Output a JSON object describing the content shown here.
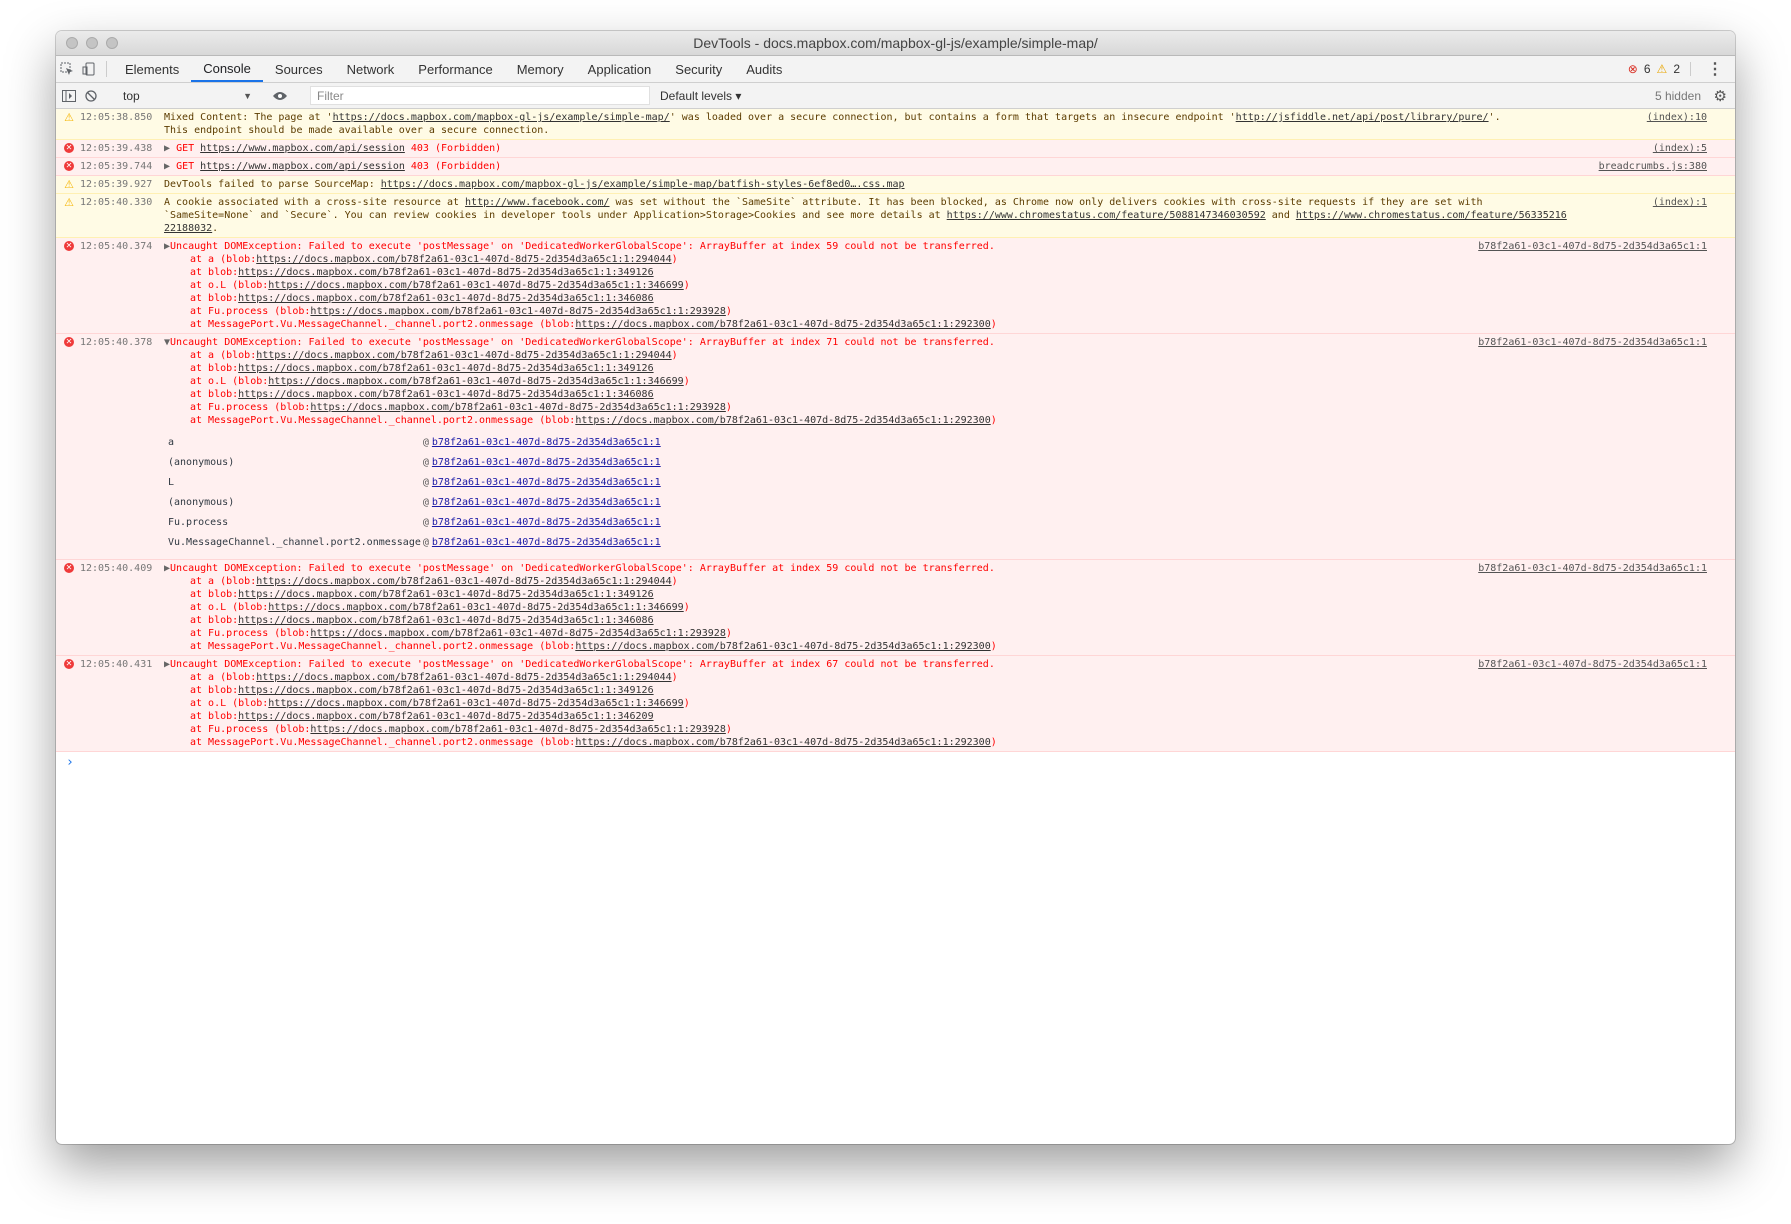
{
  "window": {
    "title": "DevTools - docs.mapbox.com/mapbox-gl-js/example/simple-map/"
  },
  "tabs": [
    "Elements",
    "Console",
    "Sources",
    "Network",
    "Performance",
    "Memory",
    "Application",
    "Security",
    "Audits"
  ],
  "active_tab": "Console",
  "counts": {
    "errors": "6",
    "warnings": "2"
  },
  "toolbar": {
    "context": "top",
    "filter_placeholder": "Filter",
    "levels": "Default levels ▾",
    "hidden": "5 hidden"
  },
  "colors": {
    "error_bg": "#fff0f0",
    "warn_bg": "#fffbe5",
    "error_text": "#ff0000",
    "accent": "#1a73e8"
  },
  "messages": {
    "m1": {
      "time": "12:05:38.850",
      "src": "(index):10",
      "t1": "Mixed Content: The page at '",
      "l1": "https://docs.mapbox.com/mapbox-gl-js/example/simple-map/",
      "t2": "' was loaded over a secure connection, but contains a form that targets an insecure endpoint '",
      "l2": "http://jsfiddle.net/api/post/library/pure/",
      "t3": "'.",
      "t4": "This endpoint should be made available over a secure connection."
    },
    "m2": {
      "time": "12:05:39.438",
      "method": "GET",
      "url": "https://www.mapbox.com/api/session",
      "status": "403 (Forbidden)",
      "src": "(index):5"
    },
    "m3": {
      "time": "12:05:39.744",
      "method": "GET",
      "url": "https://www.mapbox.com/api/session",
      "status": "403 (Forbidden)",
      "src": "breadcrumbs.js:380"
    },
    "m4": {
      "time": "12:05:39.927",
      "text": "DevTools failed to parse SourceMap: ",
      "link": "https://docs.mapbox.com/mapbox-gl-js/example/simple-map/batfish-styles-6ef8ed0….css.map"
    },
    "m5": {
      "time": "12:05:40.330",
      "src": "(index):1",
      "t1": "A cookie associated with a cross-site resource at ",
      "l1": "http://www.facebook.com/",
      "t2": " was set without the `SameSite` attribute. It has been blocked, as Chrome now only delivers cookies with cross-site requests if they are set with",
      "t3": "`SameSite=None` and `Secure`. You can review cookies in developer tools under Application>Storage>Cookies and see more details at ",
      "l2": "https://www.chromestatus.com/feature/5088147346030592",
      "t4": " and ",
      "l3": "https://www.chromestatus.com/feature/56335216",
      "l4": "22188032",
      "t5": "."
    },
    "e1": {
      "time": "12:05:40.374",
      "src": "b78f2a61-03c1-407d-8d75-2d354d3a65c1:1",
      "head": "Uncaught DOMException: Failed to execute 'postMessage' on 'DedicatedWorkerGlobalScope': ArrayBuffer at index 59 could not be transferred.",
      "s1a": "at a (blob:",
      "s1b": "https://docs.mapbox.com/b78f2a61-03c1-407d-8d75-2d354d3a65c1:1:294044",
      "s1c": ")",
      "s2a": "at blob:",
      "s2b": "https://docs.mapbox.com/b78f2a61-03c1-407d-8d75-2d354d3a65c1:1:349126",
      "s3a": "at o.L (blob:",
      "s3b": "https://docs.mapbox.com/b78f2a61-03c1-407d-8d75-2d354d3a65c1:1:346699",
      "s3c": ")",
      "s4a": "at blob:",
      "s4b": "https://docs.mapbox.com/b78f2a61-03c1-407d-8d75-2d354d3a65c1:1:346086",
      "s5a": "at Fu.process (blob:",
      "s5b": "https://docs.mapbox.com/b78f2a61-03c1-407d-8d75-2d354d3a65c1:1:293928",
      "s5c": ")",
      "s6a": "at MessagePort.Vu.MessageChannel._channel.port2.onmessage (blob:",
      "s6b": "https://docs.mapbox.com/b78f2a61-03c1-407d-8d75-2d354d3a65c1:1:292300",
      "s6c": ")"
    },
    "e2": {
      "time": "12:05:40.378",
      "src": "b78f2a61-03c1-407d-8d75-2d354d3a65c1:1",
      "head": "Uncaught DOMException: Failed to execute 'postMessage' on 'DedicatedWorkerGlobalScope': ArrayBuffer at index 71 could not be transferred.",
      "s1a": "at a (blob:",
      "s1b": "https://docs.mapbox.com/b78f2a61-03c1-407d-8d75-2d354d3a65c1:1:294044",
      "s1c": ")",
      "s2a": "at blob:",
      "s2b": "https://docs.mapbox.com/b78f2a61-03c1-407d-8d75-2d354d3a65c1:1:349126",
      "s3a": "at o.L (blob:",
      "s3b": "https://docs.mapbox.com/b78f2a61-03c1-407d-8d75-2d354d3a65c1:1:346699",
      "s3c": ")",
      "s4a": "at blob:",
      "s4b": "https://docs.mapbox.com/b78f2a61-03c1-407d-8d75-2d354d3a65c1:1:346086",
      "s5a": "at Fu.process (blob:",
      "s5b": "https://docs.mapbox.com/b78f2a61-03c1-407d-8d75-2d354d3a65c1:1:293928",
      "s5c": ")",
      "s6a": "at MessagePort.Vu.MessageChannel._channel.port2.onmessage (blob:",
      "s6b": "https://docs.mapbox.com/b78f2a61-03c1-407d-8d75-2d354d3a65c1:1:292300",
      "s6c": ")",
      "trace": {
        "at": "@",
        "f1": "a",
        "u1": "b78f2a61-03c1-407d-8d75-2d354d3a65c1:1",
        "f2": "(anonymous)",
        "u2": "b78f2a61-03c1-407d-8d75-2d354d3a65c1:1",
        "f3": "L",
        "u3": "b78f2a61-03c1-407d-8d75-2d354d3a65c1:1",
        "f4": "(anonymous)",
        "u4": "b78f2a61-03c1-407d-8d75-2d354d3a65c1:1",
        "f5": "Fu.process",
        "u5": "b78f2a61-03c1-407d-8d75-2d354d3a65c1:1",
        "f6": "Vu.MessageChannel._channel.port2.onmessage",
        "u6": "b78f2a61-03c1-407d-8d75-2d354d3a65c1:1"
      }
    },
    "e3": {
      "time": "12:05:40.409",
      "src": "b78f2a61-03c1-407d-8d75-2d354d3a65c1:1",
      "head": "Uncaught DOMException: Failed to execute 'postMessage' on 'DedicatedWorkerGlobalScope': ArrayBuffer at index 59 could not be transferred.",
      "s1a": "at a (blob:",
      "s1b": "https://docs.mapbox.com/b78f2a61-03c1-407d-8d75-2d354d3a65c1:1:294044",
      "s1c": ")",
      "s2a": "at blob:",
      "s2b": "https://docs.mapbox.com/b78f2a61-03c1-407d-8d75-2d354d3a65c1:1:349126",
      "s3a": "at o.L (blob:",
      "s3b": "https://docs.mapbox.com/b78f2a61-03c1-407d-8d75-2d354d3a65c1:1:346699",
      "s3c": ")",
      "s4a": "at blob:",
      "s4b": "https://docs.mapbox.com/b78f2a61-03c1-407d-8d75-2d354d3a65c1:1:346086",
      "s5a": "at Fu.process (blob:",
      "s5b": "https://docs.mapbox.com/b78f2a61-03c1-407d-8d75-2d354d3a65c1:1:293928",
      "s5c": ")",
      "s6a": "at MessagePort.Vu.MessageChannel._channel.port2.onmessage (blob:",
      "s6b": "https://docs.mapbox.com/b78f2a61-03c1-407d-8d75-2d354d3a65c1:1:292300",
      "s6c": ")"
    },
    "e4": {
      "time": "12:05:40.431",
      "src": "b78f2a61-03c1-407d-8d75-2d354d3a65c1:1",
      "head": "Uncaught DOMException: Failed to execute 'postMessage' on 'DedicatedWorkerGlobalScope': ArrayBuffer at index 67 could not be transferred.",
      "s1a": "at a (blob:",
      "s1b": "https://docs.mapbox.com/b78f2a61-03c1-407d-8d75-2d354d3a65c1:1:294044",
      "s1c": ")",
      "s2a": "at blob:",
      "s2b": "https://docs.mapbox.com/b78f2a61-03c1-407d-8d75-2d354d3a65c1:1:349126",
      "s3a": "at o.L (blob:",
      "s3b": "https://docs.mapbox.com/b78f2a61-03c1-407d-8d75-2d354d3a65c1:1:346699",
      "s3c": ")",
      "s4a": "at blob:",
      "s4b": "https://docs.mapbox.com/b78f2a61-03c1-407d-8d75-2d354d3a65c1:1:346209",
      "s5a": "at Fu.process (blob:",
      "s5b": "https://docs.mapbox.com/b78f2a61-03c1-407d-8d75-2d354d3a65c1:1:293928",
      "s5c": ")",
      "s6a": "at MessagePort.Vu.MessageChannel._channel.port2.onmessage (blob:",
      "s6b": "https://docs.mapbox.com/b78f2a61-03c1-407d-8d75-2d354d3a65c1:1:292300",
      "s6c": ")"
    }
  },
  "prompt": "›"
}
